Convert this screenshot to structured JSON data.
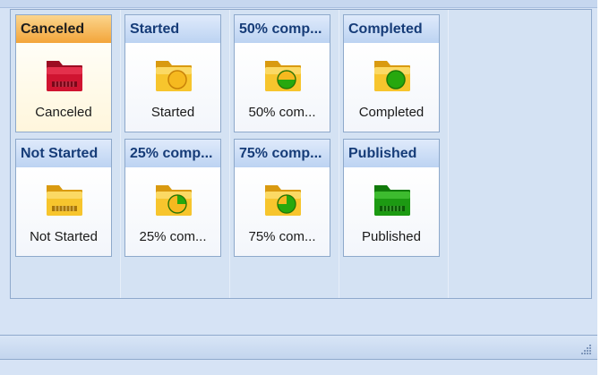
{
  "cards": [
    {
      "header": "Canceled",
      "label": "Canceled",
      "status": "canceled",
      "selected": true
    },
    {
      "header": "Started",
      "label": "Started",
      "status": "started"
    },
    {
      "header": "50% comp...",
      "label": "50% com...",
      "status": "50-percent-complete"
    },
    {
      "header": "Completed",
      "label": "Completed",
      "status": "completed"
    },
    {
      "header": "Not Started",
      "label": "Not Started",
      "status": "not-started"
    },
    {
      "header": "25% comp...",
      "label": "25% com...",
      "status": "25-percent-complete"
    },
    {
      "header": "75% comp...",
      "label": "75% com...",
      "status": "75-percent-complete"
    },
    {
      "header": "Published",
      "label": "Published",
      "status": "published"
    }
  ],
  "icons": {
    "canceled": "red-folder-icon",
    "started": "yellow-folder-empty-circle-icon",
    "pct50": "yellow-folder-half-green-circle-icon",
    "completed": "yellow-folder-green-circle-icon",
    "notstarted": "yellow-folder-icon",
    "pct25": "yellow-folder-quarter-green-circle-icon",
    "pct75": "yellow-folder-three-quarter-green-circle-icon",
    "published": "green-folder-icon"
  },
  "colors": {
    "selected_header": "#f3a53a",
    "header_text": "#163c78",
    "folder_yellow": "#f7c52d",
    "progress_green": "#27a80e",
    "canceled_red": "#c6102e",
    "published_green": "#1c9a12"
  }
}
